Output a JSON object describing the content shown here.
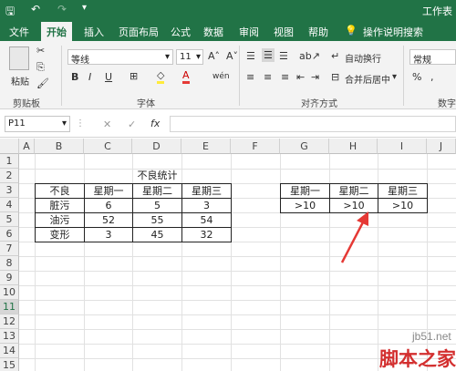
{
  "window": {
    "title": "工作表"
  },
  "qat": {
    "save": "🖫",
    "undo": "↶",
    "redo": "↷",
    "more": "▾"
  },
  "ribbon_tabs": [
    "文件",
    "开始",
    "插入",
    "页面布局",
    "公式",
    "数据",
    "审阅",
    "视图",
    "帮助"
  ],
  "tell_me": "操作说明搜索",
  "clipboard": {
    "paste": "粘贴",
    "group": "剪贴板"
  },
  "font": {
    "name": "等线",
    "size": "11",
    "grow": "A˄",
    "shrink": "A˅",
    "bold": "B",
    "italic": "I",
    "underline": "U",
    "border": "⊞",
    "fill": "◇",
    "fontcolor": "A",
    "phonetic": "wén",
    "group": "字体"
  },
  "alignment": {
    "wrap": "自动换行",
    "merge": "合并后居中",
    "group": "对齐方式"
  },
  "number": {
    "format": "常规",
    "percent": "%",
    "comma": ",",
    "group": "数字"
  },
  "formula_bar": {
    "name_box": "P11",
    "cancel": "✕",
    "enter": "✓",
    "fx": "fx",
    "value": ""
  },
  "columns": [
    "A",
    "B",
    "C",
    "D",
    "E",
    "F",
    "G",
    "H",
    "I",
    "J"
  ],
  "rows": [
    "1",
    "2",
    "3",
    "4",
    "5",
    "6",
    "7",
    "8",
    "9",
    "10",
    "11",
    "12",
    "13",
    "14",
    "15"
  ],
  "sheet": {
    "title": "不良统计",
    "table1": {
      "headers": [
        "不良",
        "星期一",
        "星期二",
        "星期三"
      ],
      "rows": [
        [
          "脏污",
          "6",
          "5",
          "3"
        ],
        [
          "油污",
          "52",
          "55",
          "54"
        ],
        [
          "变形",
          "3",
          "45",
          "32"
        ]
      ]
    },
    "table2": {
      "headers": [
        "星期一",
        "星期二",
        "星期三"
      ],
      "values": [
        ">10",
        ">10",
        ">10"
      ]
    }
  },
  "watermark": {
    "site": "jb51.net",
    "brand": "脚本之家"
  },
  "colors": {
    "excel_green": "#217346",
    "arrow": "#e53935",
    "selected_row_header": "#d6d6d6"
  }
}
